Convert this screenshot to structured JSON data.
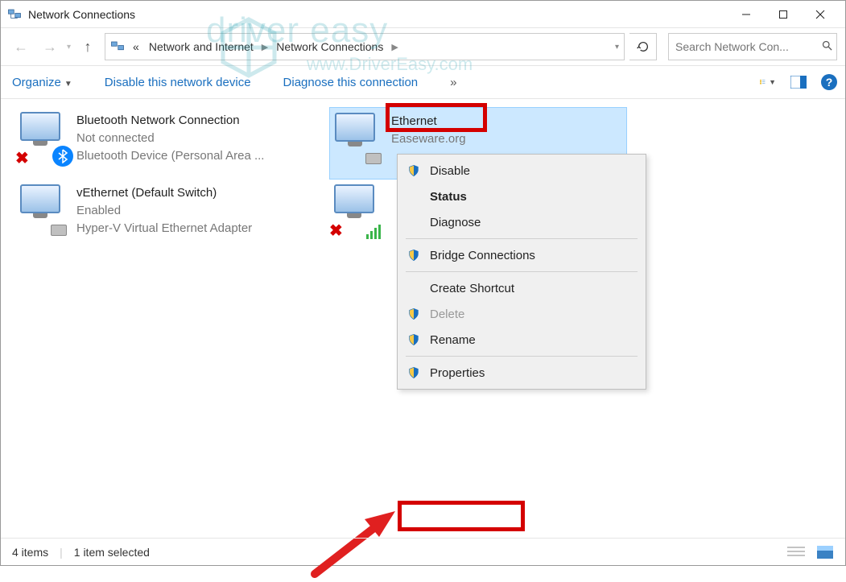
{
  "window": {
    "title": "Network Connections"
  },
  "breadcrumb": {
    "prefix": "«",
    "part1": "Network and Internet",
    "part2": "Network Connections"
  },
  "search": {
    "placeholder": "Search Network Con..."
  },
  "toolbar": {
    "organize": "Organize",
    "disable": "Disable this network device",
    "diagnose": "Diagnose this connection",
    "more": "»"
  },
  "connections": [
    {
      "name": "Bluetooth Network Connection",
      "status": "Not connected",
      "device": "Bluetooth Device (Personal Area ...",
      "selected": false,
      "badges": [
        "red-x",
        "bluetooth"
      ]
    },
    {
      "name": "Ethernet",
      "status": "Easeware.org",
      "device": "",
      "selected": true,
      "badges": [
        "plug"
      ]
    },
    {
      "name": "vEthernet (Default Switch)",
      "status": "Enabled",
      "device": "Hyper-V Virtual Ethernet Adapter",
      "selected": false,
      "badges": [
        "plug"
      ]
    },
    {
      "name": "",
      "status": "",
      "device": "",
      "selected": false,
      "badges": [
        "red-x",
        "signal"
      ]
    }
  ],
  "context_menu": {
    "disable": "Disable",
    "status": "Status",
    "diagnose": "Diagnose",
    "bridge": "Bridge Connections",
    "shortcut": "Create Shortcut",
    "delete": "Delete",
    "rename": "Rename",
    "properties": "Properties"
  },
  "statusbar": {
    "count": "4 items",
    "selection": "1 item selected"
  },
  "watermark": {
    "brand": "driver easy",
    "url": "www.DriverEasy.com"
  }
}
